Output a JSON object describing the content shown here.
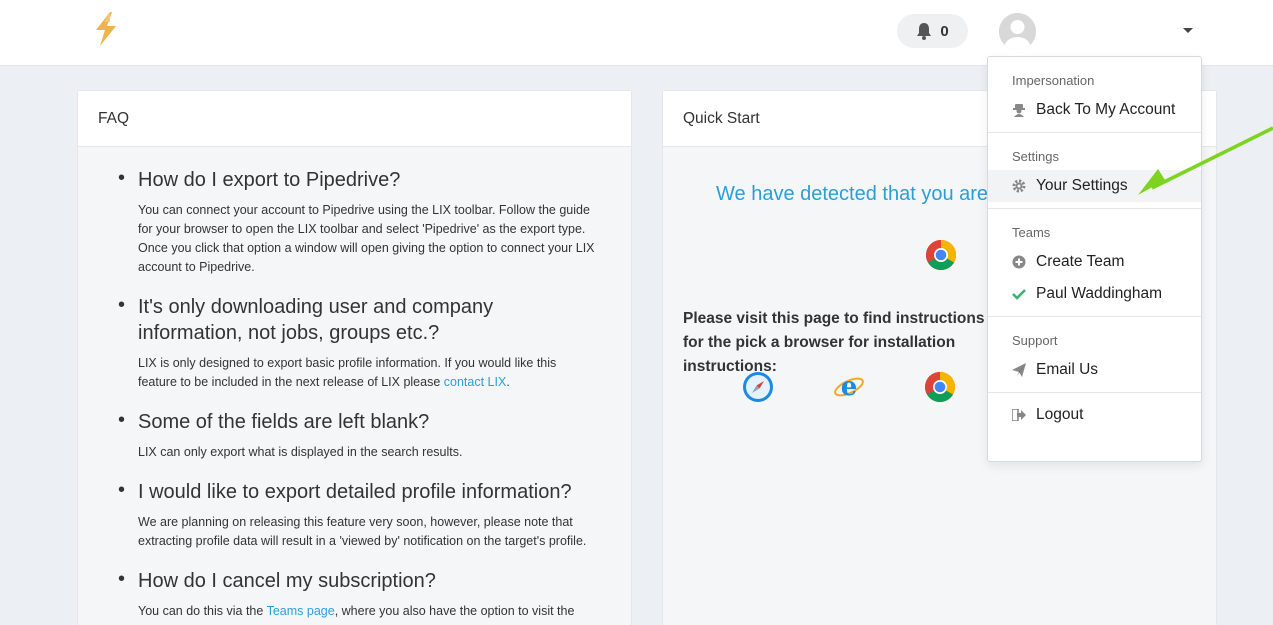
{
  "header": {
    "notifications_count": "0"
  },
  "faq": {
    "title": "FAQ",
    "items": [
      {
        "question": "How do I export to Pipedrive?",
        "answer": "You can connect your account to Pipedrive using the LIX toolbar. Follow the guide for your browser to open the LIX toolbar and select 'Pipedrive' as the export type. Once you click that option a window will open giving the option to connect your LIX account to Pipedrive."
      },
      {
        "question": "It's only downloading user and company information, not jobs, groups etc.?",
        "answer_prefix": "LIX is only designed to export basic profile information. If you would like this feature to be included in the next release of LIX please ",
        "answer_link": "contact LIX",
        "answer_suffix": "."
      },
      {
        "question": "Some of the fields are left blank?",
        "answer": "LIX can only export what is displayed in the search results."
      },
      {
        "question": "I would like to export detailed profile information?",
        "answer": "We are planning on releasing this feature very soon, however, please note that extracting profile data will result in a 'viewed by' notification on the target's profile."
      },
      {
        "question": "How do I cancel my subscription?",
        "answer_prefix": "You can do this via the ",
        "answer_link": "Teams page",
        "answer_suffix": ", where you also have the option to visit the"
      }
    ]
  },
  "quick_start": {
    "title": "Quick Start",
    "detected_text": "We have detected that you are using",
    "instructions": "Please visit this page to find instructions for the pick a browser for installation instructions:"
  },
  "dropdown": {
    "sections": [
      {
        "header": "Impersonation",
        "items": [
          {
            "label": "Back To My Account",
            "icon": "user-secret-icon"
          }
        ]
      },
      {
        "header": "Settings",
        "items": [
          {
            "label": "Your Settings",
            "icon": "gear-icon"
          }
        ]
      },
      {
        "header": "Teams",
        "items": [
          {
            "label": "Create Team",
            "icon": "plus-circle-icon"
          },
          {
            "label": "Paul Waddingham",
            "icon": "check-icon"
          }
        ]
      },
      {
        "header": "Support",
        "items": [
          {
            "label": "Email Us",
            "icon": "paper-plane-icon"
          }
        ]
      },
      {
        "header": "",
        "items": [
          {
            "label": "Logout",
            "icon": "sign-out-icon"
          }
        ]
      }
    ]
  },
  "colors": {
    "accent": "#2a9fd6",
    "arrow": "#7ed321",
    "check": "#3cb371"
  }
}
